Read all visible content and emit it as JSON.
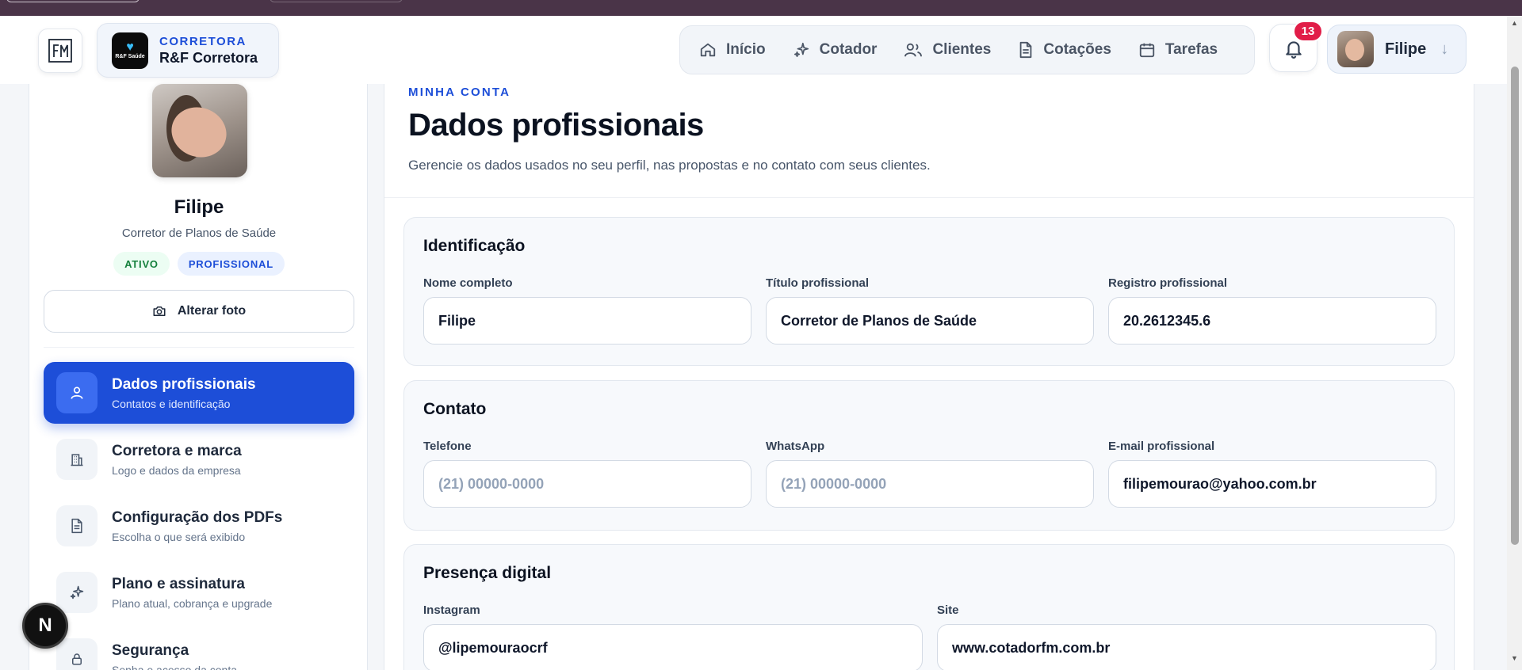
{
  "header": {
    "brand_kicker": "CORRETORA",
    "brand_name": "R&F Corretora",
    "brand_logo_text": "R&F Saúde",
    "nav": [
      {
        "label": "Início",
        "icon": "home-icon"
      },
      {
        "label": "Cotador",
        "icon": "sparkle-icon"
      },
      {
        "label": "Clientes",
        "icon": "users-icon"
      },
      {
        "label": "Cotações",
        "icon": "document-icon"
      },
      {
        "label": "Tarefas",
        "icon": "calendar-icon"
      }
    ],
    "notification_count": "13",
    "user_name": "Filipe"
  },
  "sidebar": {
    "profile_name": "Filipe",
    "profile_title": "Corretor de Planos de Saúde",
    "badges": [
      "ATIVO",
      "PROFISSIONAL"
    ],
    "change_photo_label": "Alterar foto",
    "menu": [
      {
        "title": "Dados profissionais",
        "subtitle": "Contatos e identificação",
        "icon": "user-icon",
        "active": true
      },
      {
        "title": "Corretora e marca",
        "subtitle": "Logo e dados da empresa",
        "icon": "building-icon",
        "active": false
      },
      {
        "title": "Configuração dos PDFs",
        "subtitle": "Escolha o que será exibido",
        "icon": "file-icon",
        "active": false
      },
      {
        "title": "Plano e assinatura",
        "subtitle": "Plano atual, cobrança e upgrade",
        "icon": "sparkle-icon",
        "active": false
      },
      {
        "title": "Segurança",
        "subtitle": "Senha e acesso da conta",
        "icon": "lock-icon",
        "active": false
      }
    ],
    "fab_label": "N"
  },
  "main": {
    "kicker": "MINHA CONTA",
    "title": "Dados profissionais",
    "description": "Gerencie os dados usados no seu perfil, nas propostas e no contato com seus clientes.",
    "sections": {
      "identificacao": {
        "title": "Identificação",
        "fields": [
          {
            "label": "Nome completo",
            "value": "Filipe",
            "placeholder": ""
          },
          {
            "label": "Título profissional",
            "value": "Corretor de Planos de Saúde",
            "placeholder": ""
          },
          {
            "label": "Registro profissional",
            "value": "20.2612345.6",
            "placeholder": ""
          }
        ]
      },
      "contato": {
        "title": "Contato",
        "fields": [
          {
            "label": "Telefone",
            "value": "",
            "placeholder": "(21) 00000-0000"
          },
          {
            "label": "WhatsApp",
            "value": "",
            "placeholder": "(21) 00000-0000"
          },
          {
            "label": "E-mail profissional",
            "value": "filipemourao@yahoo.com.br",
            "placeholder": ""
          }
        ]
      },
      "presenca": {
        "title": "Presença digital",
        "fields": [
          {
            "label": "Instagram",
            "value": "@lipemouraocrf",
            "placeholder": ""
          },
          {
            "label": "Site",
            "value": "www.cotadorfm.com.br",
            "placeholder": ""
          }
        ]
      }
    }
  },
  "colors": {
    "accent": "#1d4ed8",
    "badge_red": "#e11d48",
    "browser_bar": "#4a3448",
    "active_green": "#15803d"
  }
}
